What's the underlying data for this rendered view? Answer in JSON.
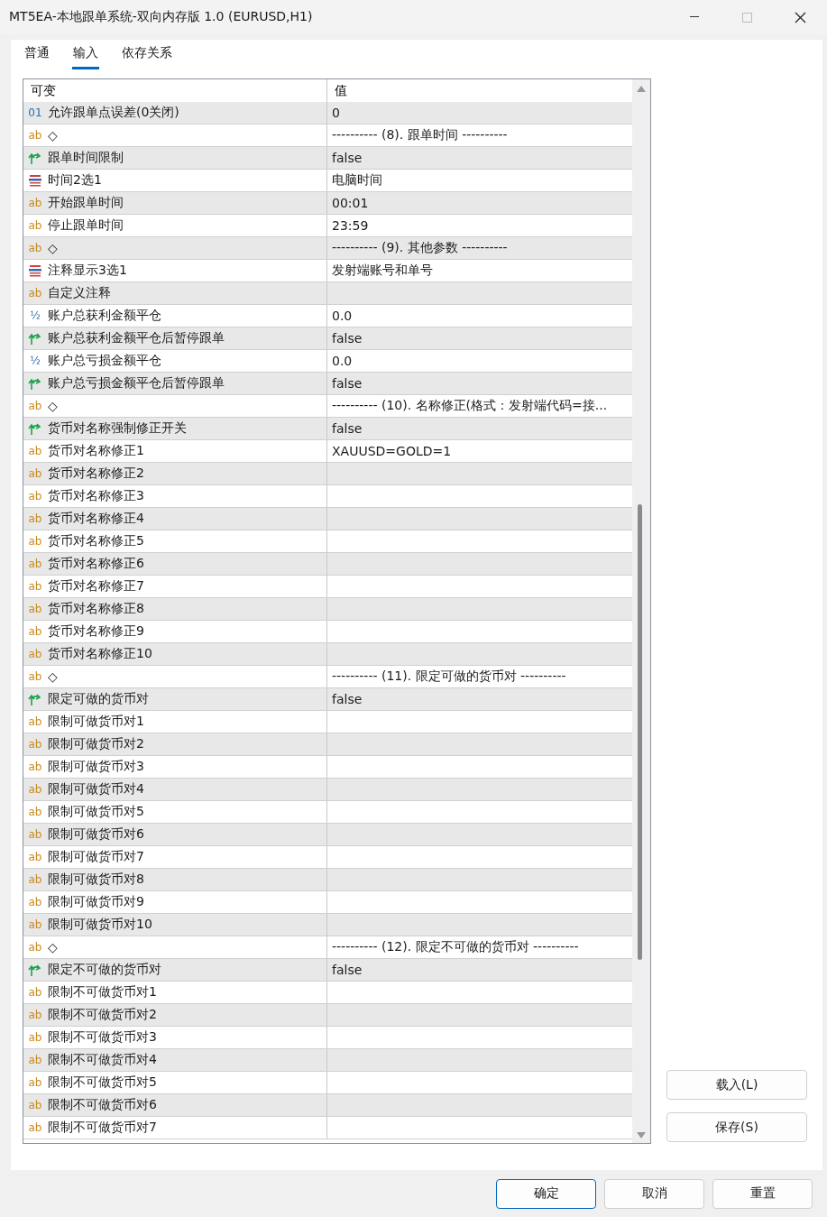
{
  "window": {
    "title": "MT5EA-本地跟单系统-双向内存版 1.0 (EURUSD,H1)"
  },
  "tabs": [
    {
      "label": "普通",
      "selected": false
    },
    {
      "label": "输入",
      "selected": true
    },
    {
      "label": "依存关系",
      "selected": false
    }
  ],
  "table": {
    "columns": [
      "可变",
      "值"
    ],
    "rows": [
      {
        "kind": "int",
        "badge": "01",
        "name": "允许跟单点误差(0关闭)",
        "value": "0"
      },
      {
        "kind": "string",
        "badge": "ab",
        "name": "◇",
        "value": "---------- (8). 跟单时间 ----------"
      },
      {
        "kind": "bool",
        "name": "跟单时间限制",
        "value": "false"
      },
      {
        "kind": "enum",
        "name": "时间2选1",
        "value": "电脑时间"
      },
      {
        "kind": "string",
        "badge": "ab",
        "name": "开始跟单时间",
        "value": "00:01"
      },
      {
        "kind": "string",
        "badge": "ab",
        "name": "停止跟单时间",
        "value": "23:59"
      },
      {
        "kind": "string",
        "badge": "ab",
        "name": "◇",
        "value": "---------- (9). 其他参数 ----------"
      },
      {
        "kind": "enum",
        "name": "注释显示3选1",
        "value": "发射端账号和单号"
      },
      {
        "kind": "string",
        "badge": "ab",
        "name": "自定义注释"
      },
      {
        "kind": "double",
        "badge": "½",
        "name": "账户总获利金额平仓",
        "value": "0.0"
      },
      {
        "kind": "bool",
        "name": "账户总获利金额平仓后暂停跟单",
        "value": "false"
      },
      {
        "kind": "double",
        "badge": "½",
        "name": "账户总亏损金额平仓",
        "value": "0.0"
      },
      {
        "kind": "bool",
        "name": "账户总亏损金额平仓后暂停跟单",
        "value": "false"
      },
      {
        "kind": "string",
        "badge": "ab",
        "name": "◇",
        "value": "---------- (10). 名称修正(格式：发射端代码=接..."
      },
      {
        "kind": "bool",
        "name": "货币对名称强制修正开关",
        "value": "false"
      },
      {
        "kind": "string",
        "badge": "ab",
        "name": "货币对名称修正1",
        "value": "XAUUSD=GOLD=1"
      },
      {
        "kind": "string",
        "badge": "ab",
        "name": "货币对名称修正2"
      },
      {
        "kind": "string",
        "badge": "ab",
        "name": "货币对名称修正3"
      },
      {
        "kind": "string",
        "badge": "ab",
        "name": "货币对名称修正4"
      },
      {
        "kind": "string",
        "badge": "ab",
        "name": "货币对名称修正5"
      },
      {
        "kind": "string",
        "badge": "ab",
        "name": "货币对名称修正6"
      },
      {
        "kind": "string",
        "badge": "ab",
        "name": "货币对名称修正7"
      },
      {
        "kind": "string",
        "badge": "ab",
        "name": "货币对名称修正8"
      },
      {
        "kind": "string",
        "badge": "ab",
        "name": "货币对名称修正9"
      },
      {
        "kind": "string",
        "badge": "ab",
        "name": "货币对名称修正10"
      },
      {
        "kind": "string",
        "badge": "ab",
        "name": "◇",
        "value": "---------- (11). 限定可做的货币对 ----------"
      },
      {
        "kind": "bool",
        "name": "限定可做的货币对",
        "value": "false"
      },
      {
        "kind": "string",
        "badge": "ab",
        "name": "限制可做货币对1"
      },
      {
        "kind": "string",
        "badge": "ab",
        "name": "限制可做货币对2"
      },
      {
        "kind": "string",
        "badge": "ab",
        "name": "限制可做货币对3"
      },
      {
        "kind": "string",
        "badge": "ab",
        "name": "限制可做货币对4"
      },
      {
        "kind": "string",
        "badge": "ab",
        "name": "限制可做货币对5"
      },
      {
        "kind": "string",
        "badge": "ab",
        "name": "限制可做货币对6"
      },
      {
        "kind": "string",
        "badge": "ab",
        "name": "限制可做货币对7"
      },
      {
        "kind": "string",
        "badge": "ab",
        "name": "限制可做货币对8"
      },
      {
        "kind": "string",
        "badge": "ab",
        "name": "限制可做货币对9"
      },
      {
        "kind": "string",
        "badge": "ab",
        "name": "限制可做货币对10"
      },
      {
        "kind": "string",
        "badge": "ab",
        "name": "◇",
        "value": "---------- (12). 限定不可做的货币对 ----------"
      },
      {
        "kind": "bool",
        "name": "限定不可做的货币对",
        "value": "false"
      },
      {
        "kind": "string",
        "badge": "ab",
        "name": "限制不可做货币对1"
      },
      {
        "kind": "string",
        "badge": "ab",
        "name": "限制不可做货币对2"
      },
      {
        "kind": "string",
        "badge": "ab",
        "name": "限制不可做货币对3"
      },
      {
        "kind": "string",
        "badge": "ab",
        "name": "限制不可做货币对4"
      },
      {
        "kind": "string",
        "badge": "ab",
        "name": "限制不可做货币对5"
      },
      {
        "kind": "string",
        "badge": "ab",
        "name": "限制不可做货币对6"
      },
      {
        "kind": "string",
        "badge": "ab",
        "name": "限制不可做货币对7"
      }
    ]
  },
  "side_buttons": [
    "载入(L)",
    "保存(S)"
  ],
  "footer_buttons": [
    {
      "label": "确定",
      "selected": true
    },
    {
      "label": "取消",
      "selected": false
    },
    {
      "label": "重置",
      "selected": false
    }
  ]
}
